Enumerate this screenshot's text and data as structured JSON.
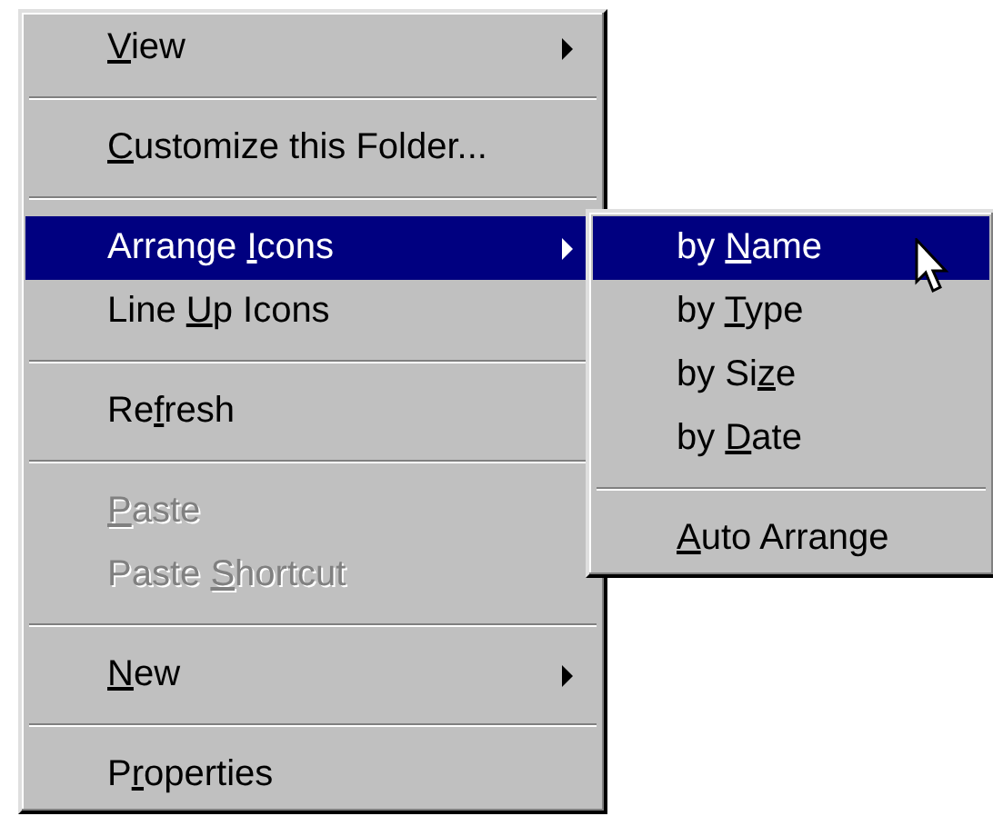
{
  "menu": {
    "items": [
      {
        "kind": "item",
        "label": [
          {
            "text": "V",
            "underline": true
          },
          {
            "text": "iew",
            "underline": false
          }
        ],
        "selected": false,
        "disabled": false,
        "has_submenu": true
      },
      {
        "kind": "separator"
      },
      {
        "kind": "item",
        "label": [
          {
            "text": "C",
            "underline": true
          },
          {
            "text": "ustomize this Folder...",
            "underline": false
          }
        ],
        "selected": false,
        "disabled": false,
        "has_submenu": false
      },
      {
        "kind": "separator"
      },
      {
        "kind": "item",
        "label": [
          {
            "text": "Arrange ",
            "underline": false
          },
          {
            "text": "I",
            "underline": true
          },
          {
            "text": "cons",
            "underline": false
          }
        ],
        "selected": true,
        "disabled": false,
        "has_submenu": true,
        "expanded": true,
        "submenu": [
          {
            "kind": "item",
            "label": [
              {
                "text": "by ",
                "underline": false
              },
              {
                "text": "N",
                "underline": true
              },
              {
                "text": "ame",
                "underline": false
              }
            ],
            "selected": true,
            "disabled": false,
            "has_submenu": false
          },
          {
            "kind": "item",
            "label": [
              {
                "text": "by ",
                "underline": false
              },
              {
                "text": "T",
                "underline": true
              },
              {
                "text": "ype",
                "underline": false
              }
            ],
            "selected": false,
            "disabled": false,
            "has_submenu": false
          },
          {
            "kind": "item",
            "label": [
              {
                "text": "by Si",
                "underline": false
              },
              {
                "text": "z",
                "underline": true
              },
              {
                "text": "e",
                "underline": false
              }
            ],
            "selected": false,
            "disabled": false,
            "has_submenu": false
          },
          {
            "kind": "item",
            "label": [
              {
                "text": "by ",
                "underline": false
              },
              {
                "text": "D",
                "underline": true
              },
              {
                "text": "ate",
                "underline": false
              }
            ],
            "selected": false,
            "disabled": false,
            "has_submenu": false
          },
          {
            "kind": "separator"
          },
          {
            "kind": "item",
            "label": [
              {
                "text": "A",
                "underline": true
              },
              {
                "text": "uto Arrange",
                "underline": false
              }
            ],
            "selected": false,
            "disabled": false,
            "has_submenu": false
          }
        ]
      },
      {
        "kind": "item",
        "label": [
          {
            "text": "Line ",
            "underline": false
          },
          {
            "text": "U",
            "underline": true
          },
          {
            "text": "p Icons",
            "underline": false
          }
        ],
        "selected": false,
        "disabled": false,
        "has_submenu": false
      },
      {
        "kind": "separator"
      },
      {
        "kind": "item",
        "label": [
          {
            "text": "Re",
            "underline": false
          },
          {
            "text": "f",
            "underline": true
          },
          {
            "text": "resh",
            "underline": false
          }
        ],
        "selected": false,
        "disabled": false,
        "has_submenu": false
      },
      {
        "kind": "separator"
      },
      {
        "kind": "item",
        "label": [
          {
            "text": "P",
            "underline": true
          },
          {
            "text": "aste",
            "underline": false
          }
        ],
        "selected": false,
        "disabled": true,
        "has_submenu": false
      },
      {
        "kind": "item",
        "label": [
          {
            "text": "Paste ",
            "underline": false
          },
          {
            "text": "S",
            "underline": true
          },
          {
            "text": "hortcut",
            "underline": false
          }
        ],
        "selected": false,
        "disabled": true,
        "has_submenu": false
      },
      {
        "kind": "separator"
      },
      {
        "kind": "item",
        "label": [
          {
            "text": "N",
            "underline": true
          },
          {
            "text": "ew",
            "underline": false
          }
        ],
        "selected": false,
        "disabled": false,
        "has_submenu": true
      },
      {
        "kind": "separator"
      },
      {
        "kind": "item",
        "label": [
          {
            "text": "P",
            "underline": false
          },
          {
            "text": "r",
            "underline": true
          },
          {
            "text": "operties",
            "underline": false
          }
        ],
        "selected": false,
        "disabled": false,
        "has_submenu": false
      }
    ]
  }
}
